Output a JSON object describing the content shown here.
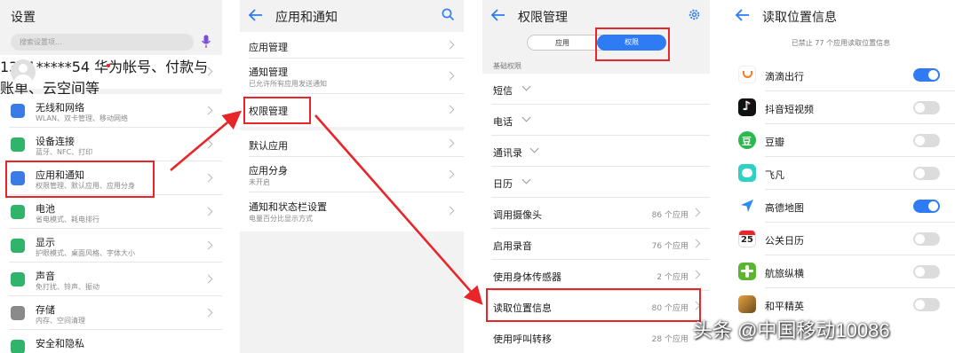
{
  "settings": {
    "title": "设置",
    "search_placeholder": "搜索设置项...",
    "account": {
      "name": "1381*****54",
      "sub": "华为帐号、付款与账单、云空间等"
    },
    "items": [
      {
        "title": "无线和网络",
        "sub": "WLAN、双卡管理、移动网络"
      },
      {
        "title": "设备连接",
        "sub": "蓝牙、NFC、打印"
      },
      {
        "title": "应用和通知",
        "sub": "权限管理、默认应用、应用分身"
      },
      {
        "title": "电池",
        "sub": "省电模式、耗电排行"
      },
      {
        "title": "显示",
        "sub": "护眼模式、桌面风格、字体大小"
      },
      {
        "title": "声音",
        "sub": "免打扰、铃声、振动"
      },
      {
        "title": "存储",
        "sub": "内存、空间清理"
      },
      {
        "title": "安全和隐私",
        "sub": ""
      }
    ]
  },
  "apps_notif": {
    "title": "应用和通知",
    "items": [
      {
        "title": "应用管理",
        "sub": ""
      },
      {
        "title": "通知管理",
        "sub": "已允许所有应用发送通知"
      },
      {
        "title": "权限管理",
        "sub": ""
      },
      {
        "title": "默认应用",
        "sub": ""
      },
      {
        "title": "应用分身",
        "sub": "未开启"
      },
      {
        "title": "通知和状态栏设置",
        "sub": "电量百分比显示方式"
      }
    ]
  },
  "perm": {
    "title": "权限管理",
    "tabs": [
      "应用",
      "权限"
    ],
    "section": "基础权限",
    "items": [
      {
        "title": "短信",
        "count": ""
      },
      {
        "title": "电话",
        "count": ""
      },
      {
        "title": "通讯录",
        "count": ""
      },
      {
        "title": "日历",
        "count": ""
      },
      {
        "title": "调用摄像头",
        "count": "86 个应用"
      },
      {
        "title": "启用录音",
        "count": "76 个应用"
      },
      {
        "title": "使用身体传感器",
        "count": "2 个应用"
      },
      {
        "title": "读取位置信息",
        "count": "80 个应用"
      },
      {
        "title": "使用呼叫转移",
        "count": "28 个应用"
      }
    ]
  },
  "location": {
    "title": "读取位置信息",
    "notice": "已禁止 77 个应用读取位置信息",
    "apps": [
      {
        "name": "滴滴出行",
        "on": true
      },
      {
        "name": "抖音短视频",
        "on": false
      },
      {
        "name": "豆瓣",
        "on": false
      },
      {
        "name": "飞凡",
        "on": false
      },
      {
        "name": "高德地图",
        "on": true
      },
      {
        "name": "公关日历",
        "on": false
      },
      {
        "name": "航旅纵横",
        "on": false
      },
      {
        "name": "和平精英",
        "on": false
      }
    ],
    "calendar_day": "25",
    "douban_glyph": "豆"
  },
  "watermark": "头条 @中国移动10086",
  "colors": {
    "accent": "#2f7bf5",
    "highlight": "#e8262a"
  }
}
